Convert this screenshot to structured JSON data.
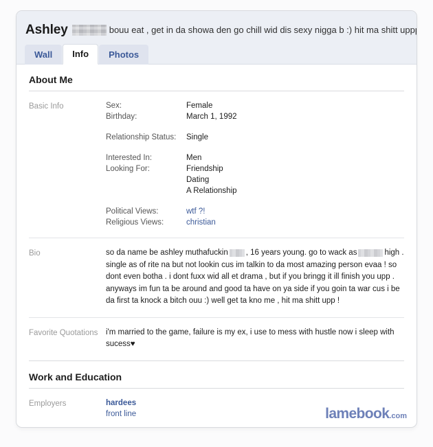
{
  "header": {
    "name": "Ashley",
    "name_redacted": true,
    "status": "bouu eat , get in da showa den go chill wid dis sexy nigga b :) hit ma shitt uppp !"
  },
  "tabs": [
    {
      "label": "Wall",
      "active": false
    },
    {
      "label": "Info",
      "active": true
    },
    {
      "label": "Photos",
      "active": false
    }
  ],
  "sections": {
    "about_me": {
      "title": "About Me",
      "basic_info": {
        "label": "Basic Info",
        "groups": [
          {
            "lines": [
              {
                "key": "Sex:",
                "value": "Female",
                "link": false
              },
              {
                "key": "Birthday:",
                "value": "March 1, 1992",
                "link": false
              }
            ]
          },
          {
            "lines": [
              {
                "key": "Relationship Status:",
                "value": "Single",
                "link": false
              }
            ]
          },
          {
            "lines": [
              {
                "key": "Interested In:",
                "value": "Men",
                "link": false
              },
              {
                "key": "Looking For:",
                "value": "Friendship",
                "link": false
              },
              {
                "key": "",
                "value": "Dating",
                "link": false
              },
              {
                "key": "",
                "value": "A Relationship",
                "link": false
              }
            ]
          },
          {
            "lines": [
              {
                "key": "Political Views:",
                "value": "wtf ?!",
                "link": true
              },
              {
                "key": "Religious Views:",
                "value": "christian",
                "link": true
              }
            ]
          }
        ]
      },
      "bio": {
        "label": "Bio",
        "text_part_1": "so da name be ashley muthafuckin",
        "text_part_2": ", 16 years young. go to wack as",
        "text_part_3": "high . single as of rite na but not lookin cus im talkin to da most amazing person evaa ! so dont even botha . i dont fuxx wid all et drama , but if you bringg it ill finish you upp . anyways im fun ta be around and good ta have on ya side if you goin ta war cus i be da first ta knock a bitch ouu :) well get ta kno me , hit ma shitt upp !"
      },
      "favorite_quotations": {
        "label": "Favorite Quotations",
        "text": "i'm married to the game, failure is my ex, i use to mess with hustle now i sleep with sucess♥"
      }
    },
    "work_and_education": {
      "title": "Work and Education",
      "employers": {
        "label": "Employers",
        "primary": "hardees",
        "secondary": "front line"
      }
    }
  },
  "watermark": {
    "name": "lamebook",
    "suffix": ".com"
  },
  "colors": {
    "accent_link": "#3b5998",
    "header_bg": "#eceff5",
    "tab_bg": "#dfe3ee",
    "watermark": "#6d80b8"
  }
}
